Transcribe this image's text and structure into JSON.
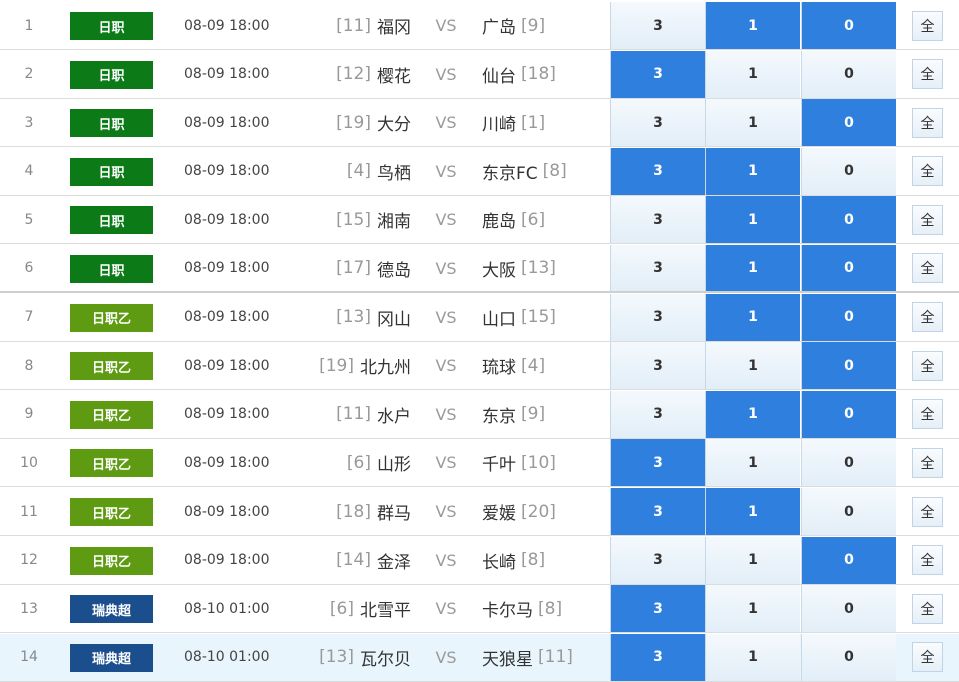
{
  "colors": {
    "jleague1": "#0b7a17",
    "jleague2": "#5e9b12",
    "allsvenskan": "#1b4e8c",
    "selected_odds": "#2f80de",
    "row_highlight": "#e9f5fd"
  },
  "matches": [
    {
      "index": "1",
      "league": "日职",
      "league_style": "j1",
      "time": "08-09 18:00",
      "home_rank": "[11]",
      "home": "福冈",
      "away": "广岛",
      "away_rank": "[9]",
      "odds": [
        "3",
        "1",
        "0"
      ],
      "selected": [
        false,
        true,
        true
      ],
      "all_label": "全",
      "highlight": false
    },
    {
      "index": "2",
      "league": "日职",
      "league_style": "j1",
      "time": "08-09 18:00",
      "home_rank": "[12]",
      "home": "樱花",
      "away": "仙台",
      "away_rank": "[18]",
      "odds": [
        "3",
        "1",
        "0"
      ],
      "selected": [
        true,
        false,
        false
      ],
      "all_label": "全",
      "highlight": false
    },
    {
      "index": "3",
      "league": "日职",
      "league_style": "j1",
      "time": "08-09 18:00",
      "home_rank": "[19]",
      "home": "大分",
      "away": "川崎",
      "away_rank": "[1]",
      "odds": [
        "3",
        "1",
        "0"
      ],
      "selected": [
        false,
        false,
        true
      ],
      "all_label": "全",
      "highlight": false
    },
    {
      "index": "4",
      "league": "日职",
      "league_style": "j1",
      "time": "08-09 18:00",
      "home_rank": "[4]",
      "home": "鸟栖",
      "away": "东京FC",
      "away_rank": "[8]",
      "odds": [
        "3",
        "1",
        "0"
      ],
      "selected": [
        true,
        true,
        false
      ],
      "all_label": "全",
      "highlight": false
    },
    {
      "index": "5",
      "league": "日职",
      "league_style": "j1",
      "time": "08-09 18:00",
      "home_rank": "[15]",
      "home": "湘南",
      "away": "鹿岛",
      "away_rank": "[6]",
      "odds": [
        "3",
        "1",
        "0"
      ],
      "selected": [
        false,
        true,
        true
      ],
      "all_label": "全",
      "highlight": false
    },
    {
      "index": "6",
      "league": "日职",
      "league_style": "j1",
      "time": "08-09 18:00",
      "home_rank": "[17]",
      "home": "德岛",
      "away": "大阪",
      "away_rank": "[13]",
      "odds": [
        "3",
        "1",
        "0"
      ],
      "selected": [
        false,
        true,
        true
      ],
      "all_label": "全",
      "highlight": false
    },
    {
      "index": "7",
      "league": "日职乙",
      "league_style": "j2",
      "time": "08-09 18:00",
      "home_rank": "[13]",
      "home": "冈山",
      "away": "山口",
      "away_rank": "[15]",
      "odds": [
        "3",
        "1",
        "0"
      ],
      "selected": [
        false,
        true,
        true
      ],
      "all_label": "全",
      "highlight": false
    },
    {
      "index": "8",
      "league": "日职乙",
      "league_style": "j2",
      "time": "08-09 18:00",
      "home_rank": "[19]",
      "home": "北九州",
      "away": "琉球",
      "away_rank": "[4]",
      "odds": [
        "3",
        "1",
        "0"
      ],
      "selected": [
        false,
        false,
        true
      ],
      "all_label": "全",
      "highlight": false
    },
    {
      "index": "9",
      "league": "日职乙",
      "league_style": "j2",
      "time": "08-09 18:00",
      "home_rank": "[11]",
      "home": "水户",
      "away": "东京",
      "away_rank": "[9]",
      "odds": [
        "3",
        "1",
        "0"
      ],
      "selected": [
        false,
        true,
        true
      ],
      "all_label": "全",
      "highlight": false
    },
    {
      "index": "10",
      "league": "日职乙",
      "league_style": "j2",
      "time": "08-09 18:00",
      "home_rank": "[6]",
      "home": "山形",
      "away": "千叶",
      "away_rank": "[10]",
      "odds": [
        "3",
        "1",
        "0"
      ],
      "selected": [
        true,
        false,
        false
      ],
      "all_label": "全",
      "highlight": false
    },
    {
      "index": "11",
      "league": "日职乙",
      "league_style": "j2",
      "time": "08-09 18:00",
      "home_rank": "[18]",
      "home": "群马",
      "away": "爱媛",
      "away_rank": "[20]",
      "odds": [
        "3",
        "1",
        "0"
      ],
      "selected": [
        true,
        true,
        false
      ],
      "all_label": "全",
      "highlight": false
    },
    {
      "index": "12",
      "league": "日职乙",
      "league_style": "j2",
      "time": "08-09 18:00",
      "home_rank": "[14]",
      "home": "金泽",
      "away": "长崎",
      "away_rank": "[8]",
      "odds": [
        "3",
        "1",
        "0"
      ],
      "selected": [
        false,
        false,
        true
      ],
      "all_label": "全",
      "highlight": false
    },
    {
      "index": "13",
      "league": "瑞典超",
      "league_style": "sw",
      "time": "08-10 01:00",
      "home_rank": "[6]",
      "home": "北雪平",
      "away": "卡尔马",
      "away_rank": "[8]",
      "odds": [
        "3",
        "1",
        "0"
      ],
      "selected": [
        true,
        false,
        false
      ],
      "all_label": "全",
      "highlight": false
    },
    {
      "index": "14",
      "league": "瑞典超",
      "league_style": "sw",
      "time": "08-10 01:00",
      "home_rank": "[13]",
      "home": "瓦尔贝",
      "away": "天狼星",
      "away_rank": "[11]",
      "odds": [
        "3",
        "1",
        "0"
      ],
      "selected": [
        true,
        false,
        false
      ],
      "all_label": "全",
      "highlight": true
    }
  ]
}
